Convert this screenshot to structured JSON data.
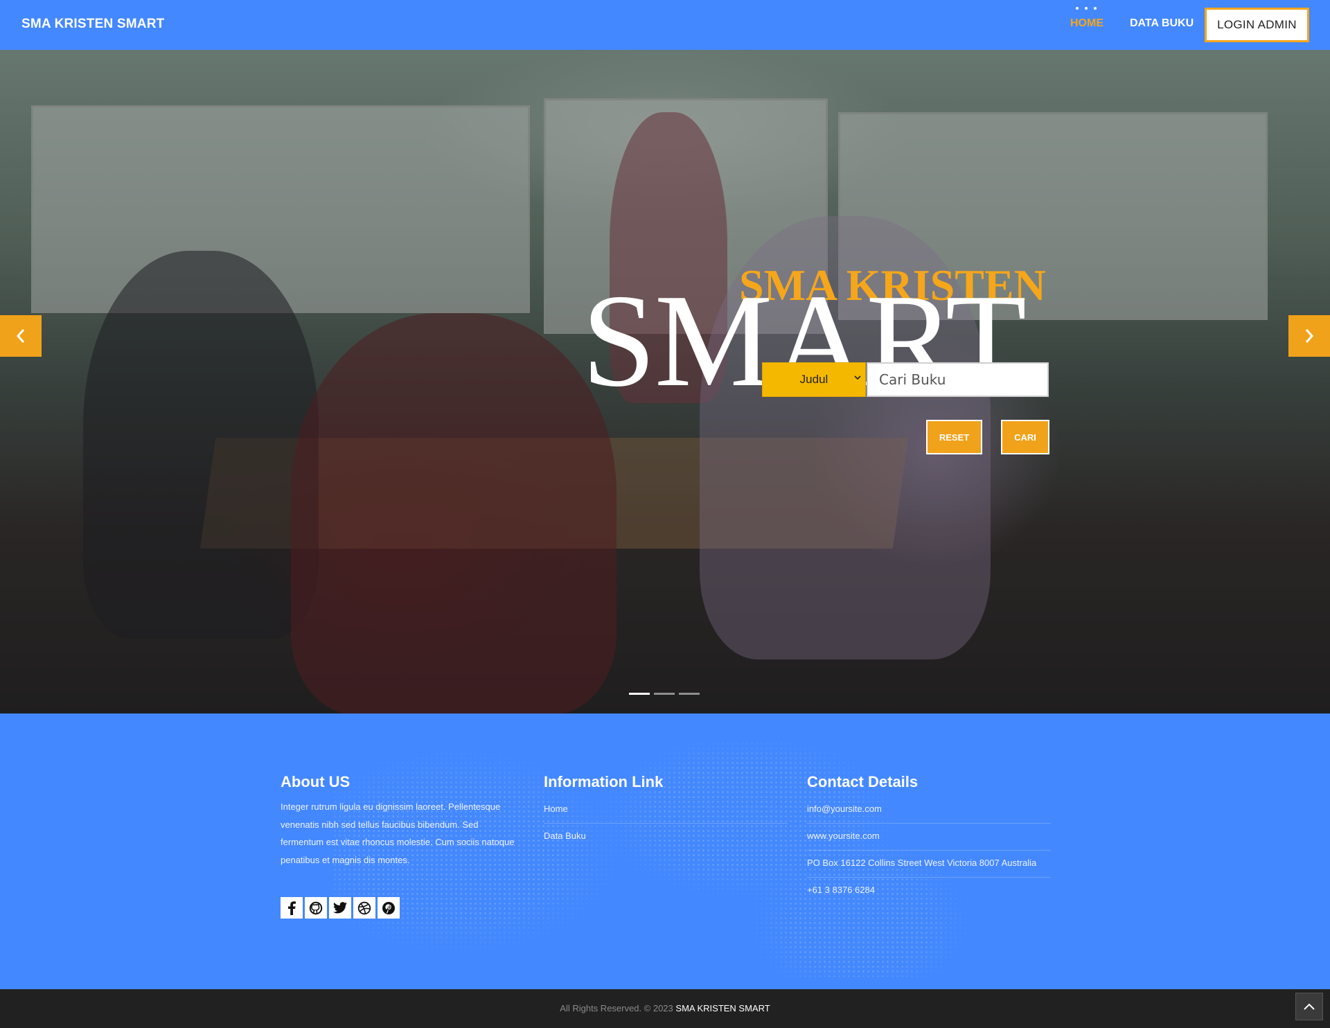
{
  "navbar": {
    "brand": "SMA KRISTEN SMART",
    "items": [
      {
        "label": "HOME",
        "active": true
      },
      {
        "label": "DATA BUKU",
        "active": false
      }
    ],
    "login_label": "LOGIN ADMIN"
  },
  "hero": {
    "subtitle": "SMA KRISTEN",
    "title": "SMART",
    "search": {
      "field_selected": "Judul",
      "placeholder": "Cari Buku"
    },
    "reset_label": "RESET",
    "search_label": "CARI",
    "slides_total": 3,
    "slide_active": 1
  },
  "footer": {
    "about": {
      "heading": "About US",
      "text": "Integer rutrum ligula eu dignissim laoreet. Pellentesque venenatis nibh sed tellus faucibus bibendum. Sed fermentum est vitae rhoncus molestie. Cum sociis natoque penatibus et magnis dis montes.",
      "socials": [
        "facebook-icon",
        "github-icon",
        "twitter-icon",
        "dribbble-icon",
        "pinterest-icon"
      ]
    },
    "info": {
      "heading": "Information Link",
      "links": [
        "Home",
        "Data Buku"
      ]
    },
    "contact": {
      "heading": "Contact Details",
      "items": [
        "info@yoursite.com",
        "www.yoursite.com",
        "PO Box 16122 Collins Street West Victoria 8007 Australia",
        "+61 3 8376 6284"
      ]
    }
  },
  "bottom": {
    "copyright_prefix": "All Rights Reserved. © 2023",
    "copyright_brand": "SMA KRISTEN SMART"
  },
  "colors": {
    "primary_blue": "#4488ff",
    "accent_orange": "#f5a61a",
    "dark": "#212121"
  }
}
